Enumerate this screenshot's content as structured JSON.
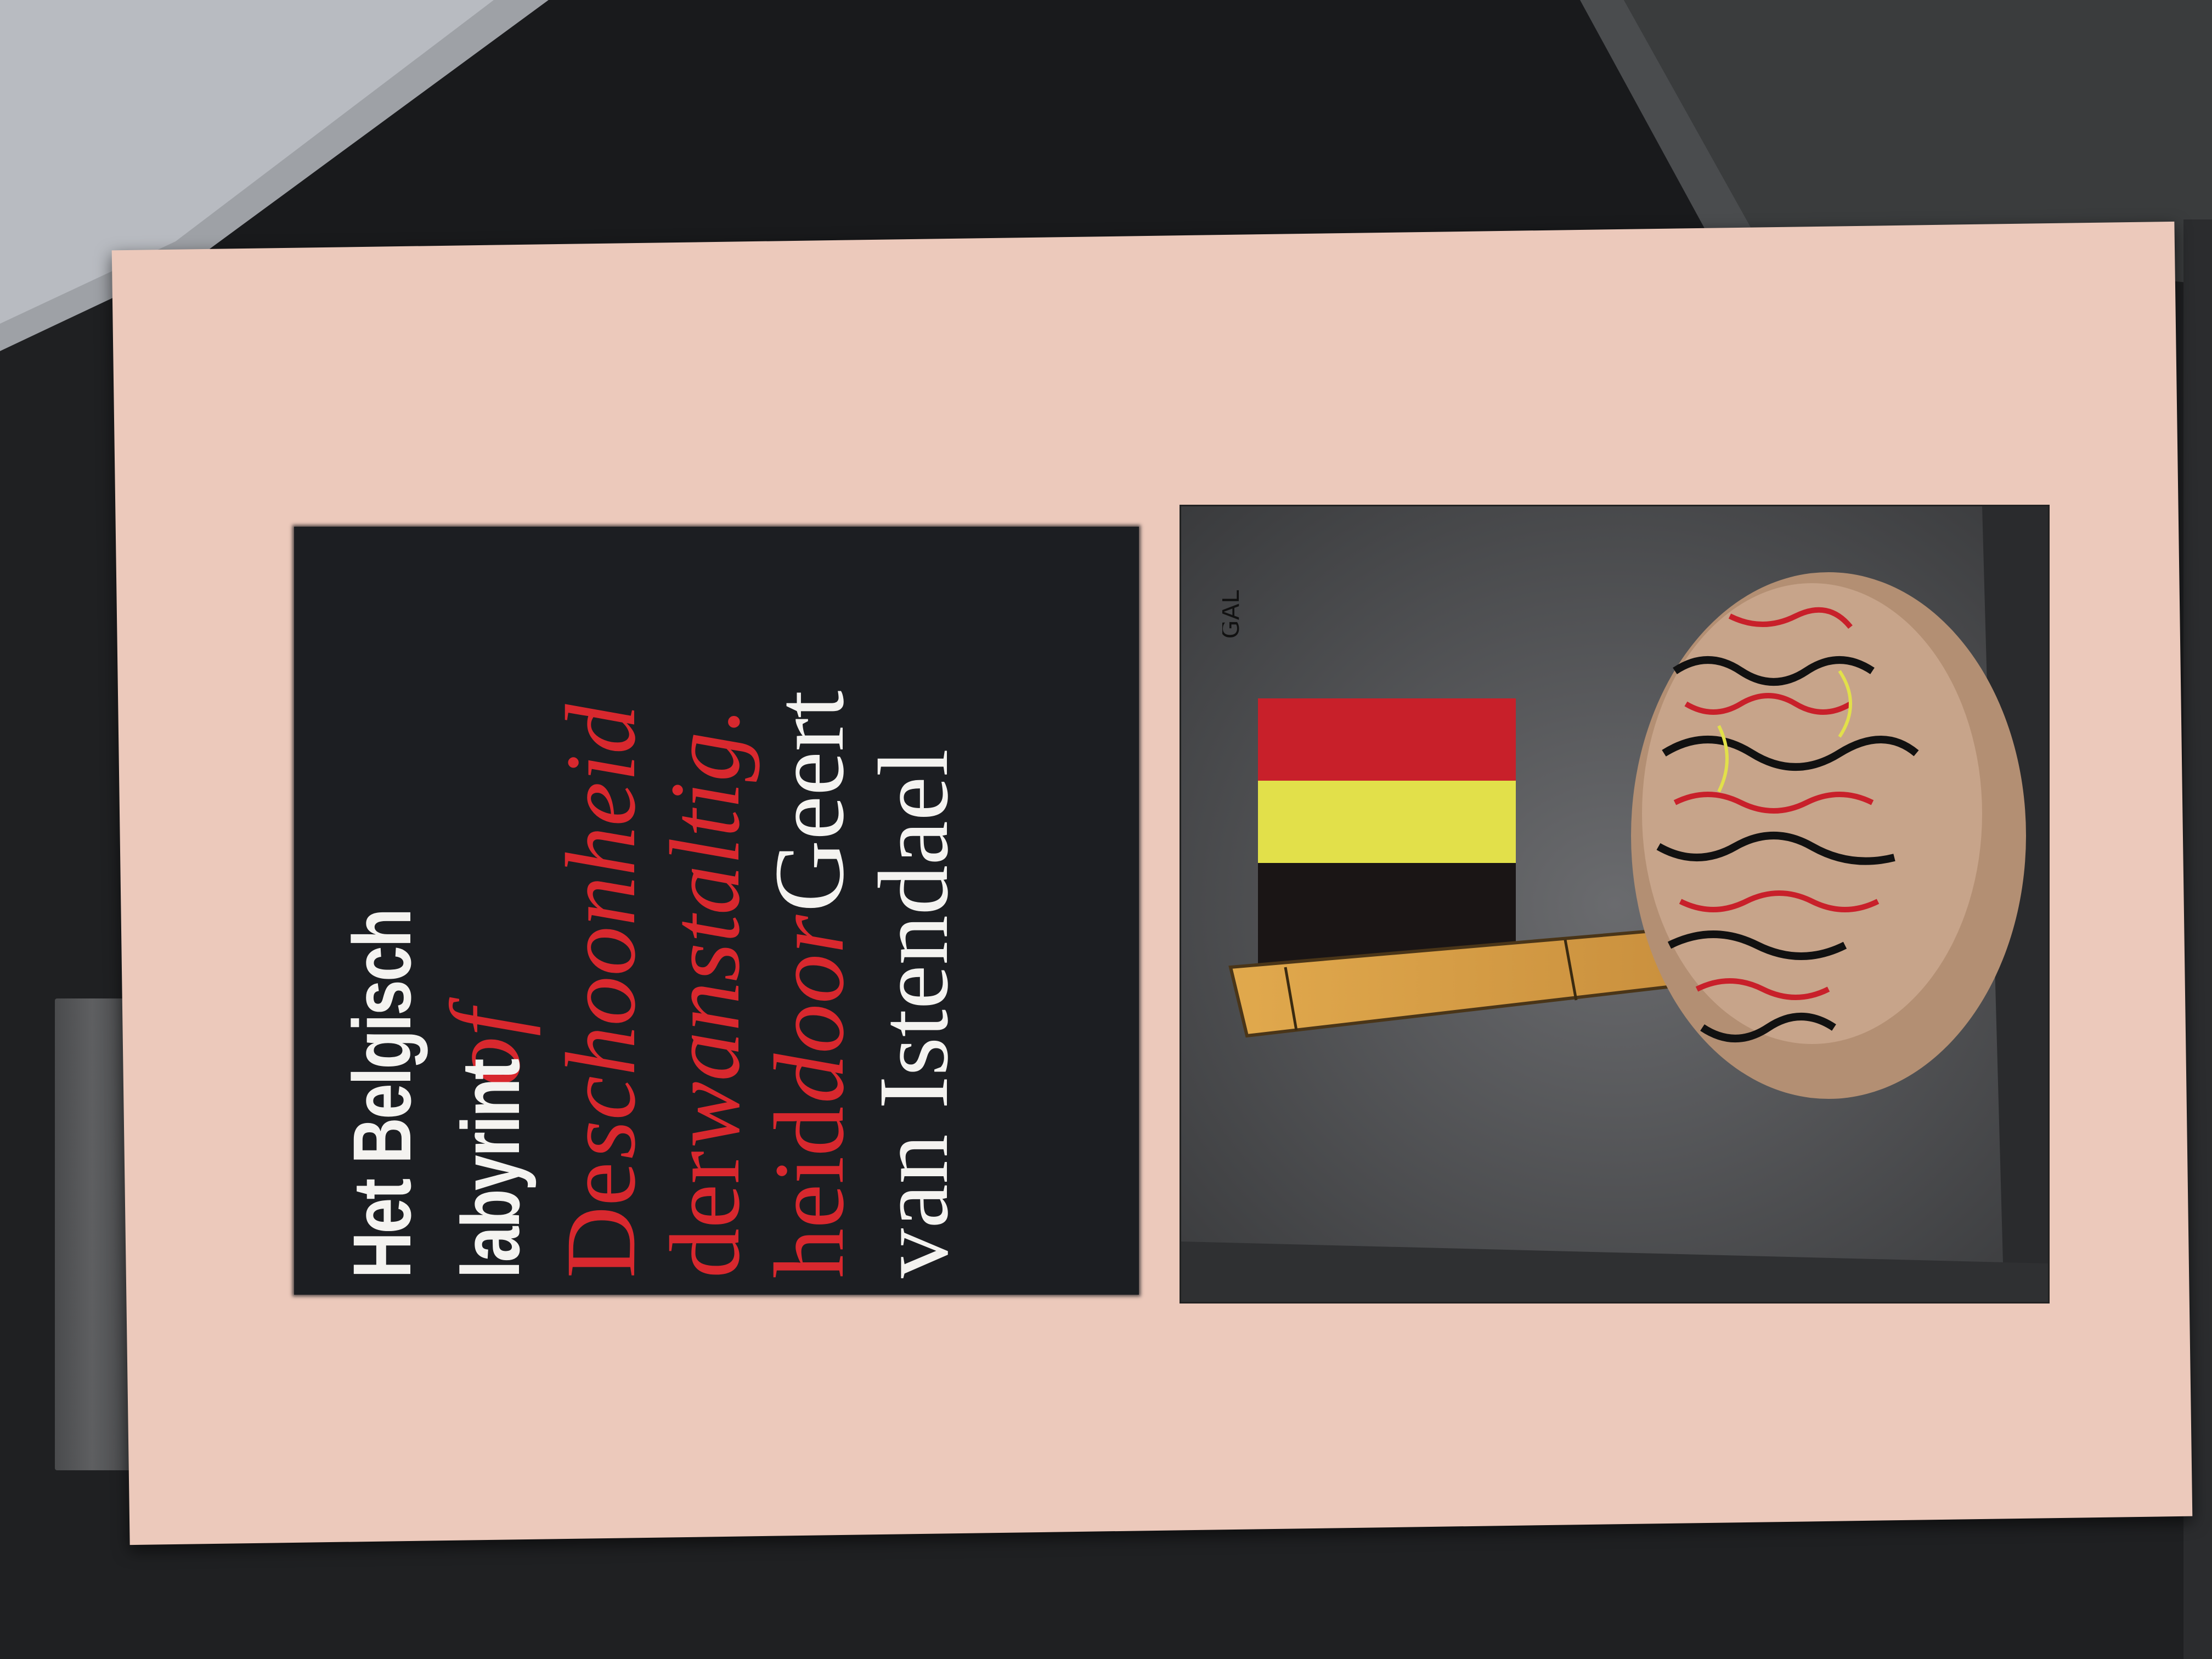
{
  "book": {
    "title_line1": "Het Belgisch",
    "title_line2": "labyrint",
    "of_word": "of",
    "subtitle_line1": "De schoonheid",
    "subtitle_schoonheid": "schoonheid",
    "subtitle_de": "De",
    "subtitle_line2_der": "der",
    "subtitle_line2_wanstaltig": "wanstaltig.",
    "subtitle_line3_heid": "heid",
    "door_word": "door",
    "author_first": "Geert",
    "author_last": "van Istendael",
    "illustrator_signature": "GAL"
  },
  "colors": {
    "cover": "#ecc9bb",
    "panel": "#1c1e22",
    "title_white": "#f4f3f0",
    "title_red": "#d8282e",
    "flag_black": "#1a1515",
    "flag_yellow": "#e2e04a",
    "flag_red": "#c8202a"
  },
  "illustration": {
    "subject": "belgian-flag-and-brain-on-stick",
    "flag_stripes": [
      "black",
      "yellow",
      "red"
    ]
  }
}
